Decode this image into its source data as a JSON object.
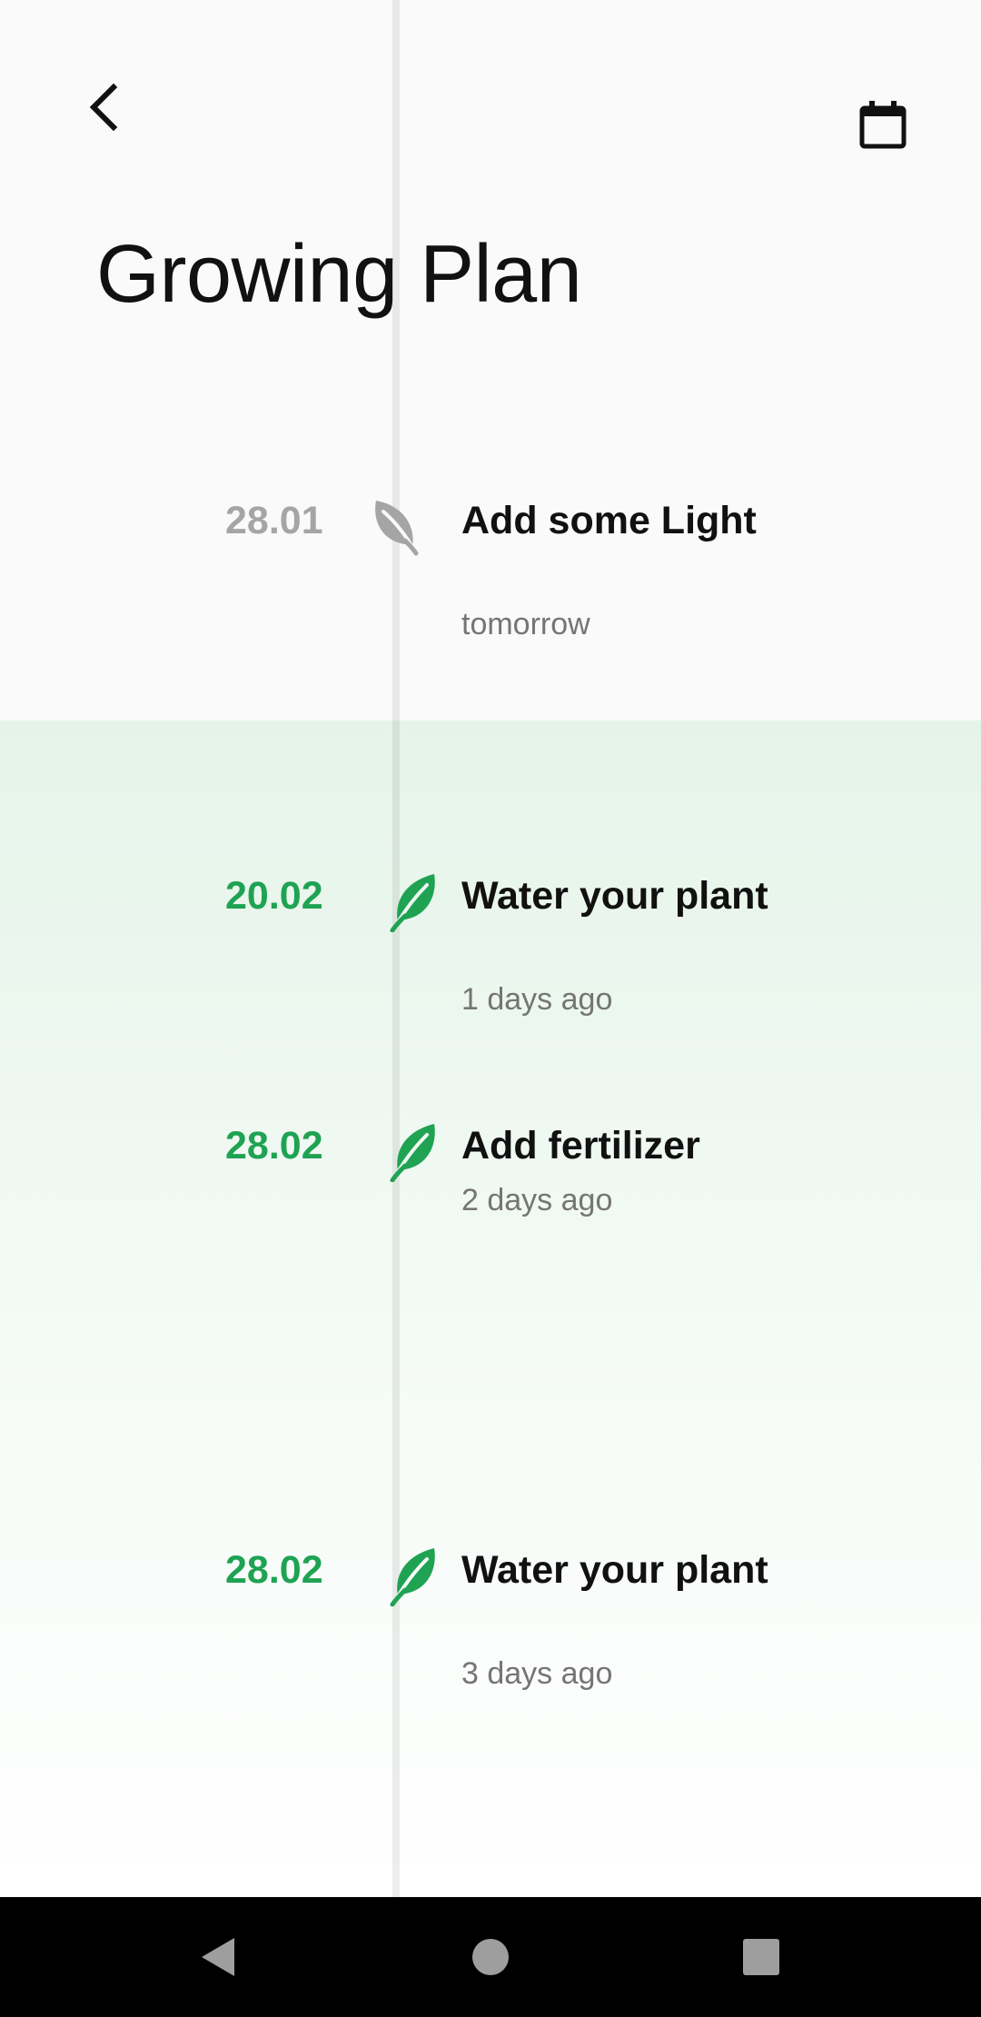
{
  "header": {
    "title": "Growing Plan",
    "back_icon": "chevron-left-icon",
    "calendar_icon": "calendar-icon"
  },
  "colors": {
    "accent_green": "#1fa353",
    "inactive_gray": "#a5a5a5",
    "text_dark": "#111111",
    "text_secondary": "#757575"
  },
  "events": [
    {
      "date": "28.01",
      "title": "Add some Light",
      "subtitle": "tomorrow",
      "status": "upcoming",
      "icon": "leaf-icon"
    },
    {
      "date": "20.02",
      "title": "Water your plant",
      "subtitle": "1 days ago",
      "status": "done",
      "icon": "leaf-icon"
    },
    {
      "date": "28.02",
      "title": "Add fertilizer",
      "subtitle": "2 days ago",
      "status": "done",
      "icon": "leaf-icon"
    },
    {
      "date": "28.02",
      "title": "Water your plant",
      "subtitle": "3 days ago",
      "status": "done",
      "icon": "leaf-icon"
    }
  ],
  "nav": {
    "back": "nav-back-icon",
    "home": "nav-home-icon",
    "recents": "nav-recents-icon"
  }
}
